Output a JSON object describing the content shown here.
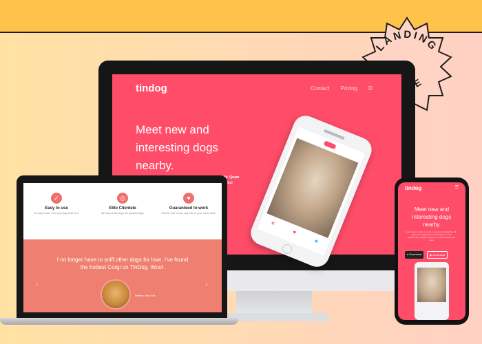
{
  "badge": {
    "line1": "LANDING",
    "line2": "PAGE"
  },
  "desktop": {
    "brand": "tindog",
    "nav": [
      "Contact",
      "Pricing",
      "D"
    ],
    "hero": [
      "Meet new and",
      "interesting dogs",
      "nearby."
    ],
    "sub_visible": [
      "e elit. Quam",
      "adipisci"
    ]
  },
  "phone_app": {
    "actions": [
      "✕",
      "♥",
      "★"
    ]
  },
  "laptop": {
    "features": [
      {
        "icon": "✓",
        "title": "Easy to use",
        "desc": "So easy to use, even your dog could do it."
      },
      {
        "icon": "◎",
        "title": "Elite Clientele",
        "desc": "We have all the dogs, the greatest dogs."
      },
      {
        "icon": "♥",
        "title": "Guaranteed to work",
        "desc": "Find the love of your dog's life or your money back."
      }
    ],
    "testimonial": "I no longer have to sniff other dogs for love. I've found the hottest Corgi on TinDog. Woof.",
    "author": "Pebbles, New York",
    "prev": "‹",
    "next": "›"
  },
  "mobile": {
    "brand": "tindog",
    "menu": "☰",
    "hero": "Meet new and interesting dogs nearby.",
    "sub": "Lorem ipsum dolor sit amet, consectetur adipisicing elit. Quam hic, laudantium exercitationem. Iusto praesentium adipisci earum eos modi ea totam sed iusto.",
    "btn_download": "● Download",
    "btn_download2": "▶ Download"
  }
}
